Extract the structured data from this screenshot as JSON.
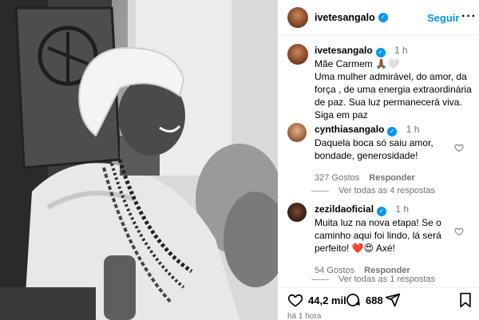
{
  "post": {
    "username": "ivetesangalo",
    "follow_label": "Seguir",
    "caption_time": "1 h",
    "caption_text": "Mãe Carmem 🙏🏾🤍\nUma mulher admirável, do amor, da força , de uma energia extraordinária de paz. Sua luz permanecerá viva.\nSiga em paz"
  },
  "comments": [
    {
      "username": "cynthiasangalo",
      "time": "1 h",
      "text": "Daquela boca só saiu amor, bondade, generosidade!",
      "likes": "327 Gostos",
      "reply_label": "Responder",
      "view_replies": "Ver todas as 4 respostas"
    },
    {
      "username": "zezildaoficial",
      "time": "1 h",
      "text": "Muita luz na nova etapa! Se o caminho aqui foi lindo, lá será perfeito! ❤️😍 Axé!",
      "likes": "54 Gostos",
      "reply_label": "Responder",
      "view_replies": "Ver todas as 1 respostas"
    }
  ],
  "footer": {
    "likes_count": "44,2 mil",
    "comments_count": "688",
    "posted_ago": "há 1 hora"
  },
  "colors": {
    "accent": "#0095f6",
    "like_red": "#ed4956",
    "muted": "#737373"
  },
  "icons": [
    "verified-badge-icon",
    "more-options-icon",
    "heart-icon",
    "comment-icon",
    "share-icon",
    "bookmark-icon"
  ]
}
